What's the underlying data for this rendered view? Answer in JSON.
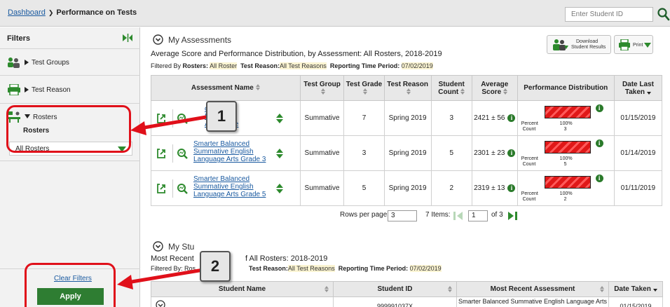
{
  "breadcrumb": {
    "home": "Dashboard",
    "current": "Performance on Tests"
  },
  "student_search": {
    "placeholder": "Enter Student ID"
  },
  "sidebar": {
    "title": "Filters",
    "sections": [
      {
        "label": "Test Groups",
        "icon": "people-icon"
      },
      {
        "label": "Test Reason",
        "icon": "printer-icon"
      },
      {
        "label": "Rosters",
        "icon": "classroom-icon",
        "sub_label": "Rosters",
        "selected": "All Rosters"
      }
    ],
    "clear_label": "Clear Filters",
    "apply_label": "Apply"
  },
  "assessments": {
    "title": "My Assessments",
    "subtitle": "Average Score and Performance Distribution, by Assessment: All Rosters, 2018-2019",
    "filter_prefix": "Filtered By",
    "filters": [
      {
        "k": "Rosters:",
        "v": "All Roster"
      },
      {
        "k": "Test Reason:",
        "v": "All Test Reasons"
      },
      {
        "k": "Reporting Time Period:",
        "v": "07/02/2019"
      }
    ],
    "download_label": "Download Student Results",
    "download_line1": "Download",
    "download_line2": "Student Results",
    "print_label": "Print",
    "columns": [
      "Assessment Name",
      "Test Group",
      "Test Grade",
      "Test Reason",
      "Student Count",
      "Average Score",
      "Performance Distribution",
      "Date Last Taken"
    ],
    "rows": [
      {
        "name": "Smarter Balanced Summative English Language Arts Grade 7",
        "name_visible": "ced\nEnglish\nArts Grade",
        "group": "Summative",
        "grade": "7",
        "reason": "Spring 2019",
        "count": "3",
        "score": "2421 ± 56",
        "percent": "100%",
        "pct_value": 100,
        "dist_count": "3",
        "date": "01/15/2019"
      },
      {
        "name": "Smarter Balanced Summative English Language Arts Grade 3",
        "group": "Summative",
        "grade": "3",
        "reason": "Spring 2019",
        "count": "5",
        "score": "2301 ± 23",
        "percent": "100%",
        "pct_value": 100,
        "dist_count": "5",
        "date": "01/14/2019"
      },
      {
        "name": "Smarter Balanced Summative English Language Arts Grade 5",
        "group": "Summative",
        "grade": "5",
        "reason": "Spring 2019",
        "count": "2",
        "score": "2319 ± 13",
        "percent": "100%",
        "pct_value": 100,
        "dist_count": "2",
        "date": "01/11/2019"
      }
    ],
    "percent_label": "Percent",
    "count_label": "Count",
    "pager": {
      "rows_label": "Rows per page:",
      "rows_value": "3",
      "items": "7 Items:",
      "page": "1",
      "of": "of 3"
    }
  },
  "students": {
    "title": "My Stu",
    "subtitle_left": "Most Recent",
    "subtitle_right": "f All Rosters: 2018-2019",
    "filter_left": "Filtered By: Ros",
    "filters": [
      {
        "k": "Test Reason:",
        "v": "All Test Reasons"
      },
      {
        "k": "Reporting Time Period:",
        "v": "07/02/2019"
      }
    ],
    "columns": [
      "Student Name",
      "Student ID",
      "Most Recent Assessment",
      "Date Taken"
    ],
    "row": {
      "id": "999991037X",
      "assessment": "Smarter Balanced Summative English Language Arts",
      "date": "01/15/2019"
    }
  },
  "callouts": [
    "1",
    "2"
  ],
  "colors": {
    "accent_green": "#2e7d32",
    "link_blue": "#1a5aa0",
    "callout_red": "#e0101a",
    "bar_red": "#e01818"
  }
}
